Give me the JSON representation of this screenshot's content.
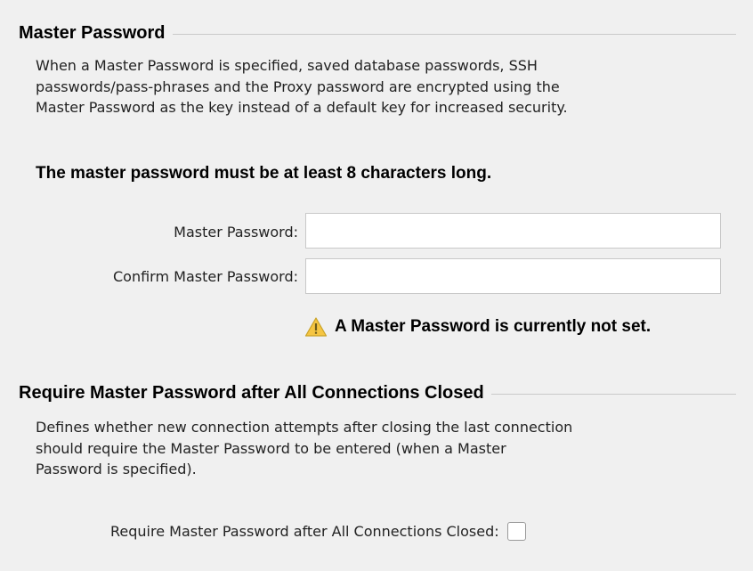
{
  "master_password_section": {
    "title": "Master Password",
    "description_lines": [
      "When a Master Password is specified, saved database passwords, SSH",
      "passwords/pass-phrases and the Proxy password are encrypted using the",
      "Master Password as the key instead of a default key for increased security."
    ],
    "length_notice": "The master password must be at least 8 characters long.",
    "master_password_label": "Master Password:",
    "master_password_value": "",
    "confirm_password_label": "Confirm Master Password:",
    "confirm_password_value": "",
    "status_icon": "warning-triangle-icon",
    "status_text": "A Master Password is currently not set."
  },
  "require_section": {
    "title": "Require Master Password after All Connections Closed",
    "description_lines": [
      "Defines whether new connection attempts after closing the last connection",
      "should require the Master Password to be entered (when a Master",
      "Password is specified)."
    ],
    "checkbox_label": "Require Master Password after All Connections Closed:",
    "checkbox_checked": false
  },
  "colors": {
    "background": "#f0f0f0",
    "warning_fill": "#f5c542",
    "input_border": "#c8c8c8"
  }
}
